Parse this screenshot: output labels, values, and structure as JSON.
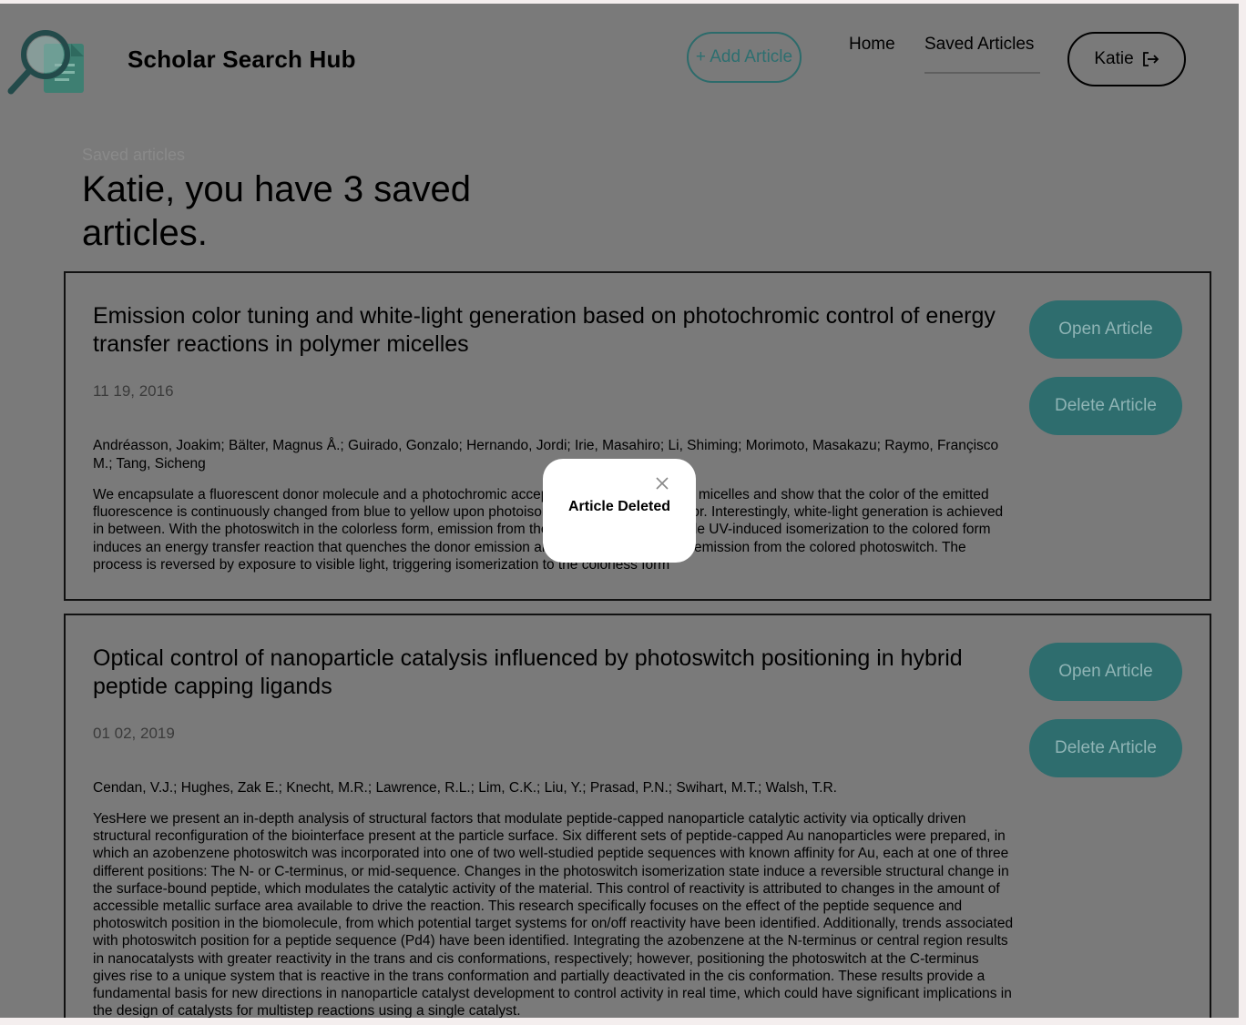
{
  "header": {
    "brand": "Scholar Search Hub",
    "add_article_label": "+ Add Article",
    "nav": [
      {
        "label": "Home"
      },
      {
        "label": "Saved Articles",
        "active": true
      }
    ],
    "user_name": "Katie",
    "logout_icon": "logout-icon"
  },
  "page": {
    "breadcrumb": "Saved articles",
    "title": "Katie, you have 3 saved articles."
  },
  "articles": [
    {
      "title": "Emission color tuning and white-light generation based on photochromic control of energy transfer reactions in polymer micelles",
      "date": "11 19, 2016",
      "authors": "Andréasson, Joakim; Bälter, Magnus Å.; Guirado, Gonzalo; Hernando, Jordi; Irie, Masahiro; Li, Shiming; Morimoto, Masakazu; Raymo, Françisco M.; Tang, Sicheng",
      "abstract": "We encapsulate a fluorescent donor molecule and a photochromic acceptor molecule in polymer micelles and show that the color of the emitted fluorescence is continuously changed from blue to yellow upon photoisomerization of the acceptor. Interestingly, white-light generation is achieved in between. With the photoswitch in the colorless form, emission from the donor is observed, while UV-induced isomerization to the colored form induces an energy transfer reaction that quenches the donor emission and sensitizes the yellow emission from the colored photoswitch. The process is reversed by exposure to visible light, triggering isomerization to the colorless form",
      "open_label": "Open Article",
      "delete_label": "Delete Article"
    },
    {
      "title": "Optical control of nanoparticle catalysis influenced by photoswitch positioning in hybrid peptide capping ligands",
      "date": "01 02, 2019",
      "authors": "Cendan, V.J.; Hughes, Zak E.; Knecht, M.R.; Lawrence, R.L.; Lim, C.K.; Liu, Y.; Prasad, P.N.; Swihart, M.T.; Walsh, T.R.",
      "abstract": "YesHere we present an in-depth analysis of structural factors that modulate peptide-capped nanoparticle catalytic activity via optically driven structural reconfiguration of the biointerface present at the particle surface. Six different sets of peptide-capped Au nanoparticles were prepared, in which an azobenzene photoswitch was incorporated into one of two well-studied peptide sequences with known affinity for Au, each at one of three different positions: The N- or C-terminus, or mid-sequence. Changes in the photoswitch isomerization state induce a reversible structural change in the surface-bound peptide, which modulates the catalytic activity of the material. This control of reactivity is attributed to changes in the amount of accessible metallic surface area available to drive the reaction. This research specifically focuses on the effect of the peptide sequence and photoswitch position in the biomolecule, from which potential target systems for on/off reactivity have been identified. Additionally, trends associated with photoswitch position for a peptide sequence (Pd4) have been identified. Integrating the azobenzene at the N-terminus or central region results in nanocatalysts with greater reactivity in the trans and cis conformations, respectively; however, positioning the photoswitch at the C-terminus gives rise to a unique system that is reactive in the trans conformation and partially deactivated in the cis conformation. These results provide a fundamental basis for new directions in nanoparticle catalyst development to control activity in real time, which could have significant implications in the design of catalysts for multistep reactions using a single catalyst.",
      "open_label": "Open Article",
      "delete_label": "Delete Article"
    }
  ],
  "modal": {
    "message": "Article Deleted",
    "close_icon": "close-icon"
  },
  "colors": {
    "overlay": "#7a7a7a",
    "accent_teal": "#2e6d6e",
    "modal_bg": "#ffffff"
  }
}
